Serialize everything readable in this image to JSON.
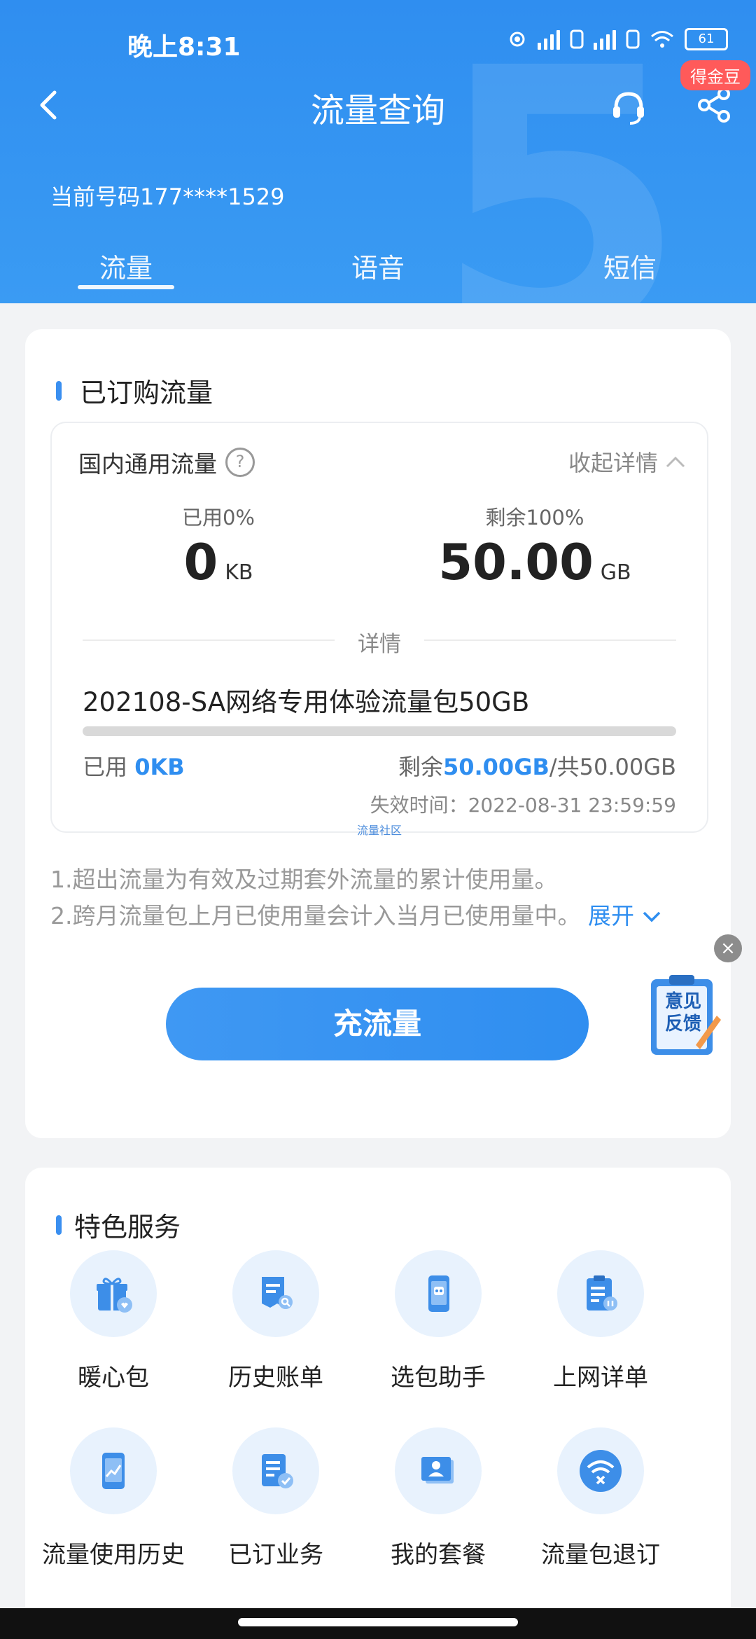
{
  "status_bar": {
    "time": "晚上8:31",
    "battery": "61"
  },
  "navbar": {
    "title": "流量查询",
    "badge": "得金豆"
  },
  "phone_label": "当前号码177****1529",
  "tabs": [
    {
      "label": "流量",
      "active": true
    },
    {
      "label": "语音",
      "active": false
    },
    {
      "label": "短信",
      "active": false
    }
  ],
  "subscribed": {
    "title": "已订购流量",
    "category": "国内通用流量",
    "collapse_label": "收起详情",
    "used_pct_label": "已用0%",
    "used_value": "0",
    "used_unit": "KB",
    "remain_pct_label": "剩余100%",
    "remain_value": "50.00",
    "remain_unit": "GB",
    "divider_label": "详情",
    "package_name": "202108-SA网络专用体验流量包50GB",
    "progress_fraction": 0,
    "used_prefix": "已用 ",
    "used_amount": "0KB",
    "remain_prefix": "剩余",
    "remain_amount": "50.00GB",
    "total_suffix": "/共50.00GB",
    "expire_label": "失效时间：2022-08-31 23:59:59",
    "watermark": "流量社区"
  },
  "notes": {
    "line1": "1.超出流量为有效及过期套外流量的累计使用量。",
    "line2": "2.跨月流量包上月已使用量会计入当月已使用量中。",
    "expand_label": "展开"
  },
  "recharge_label": "充流量",
  "feedback": {
    "line1": "意见",
    "line2": "反馈"
  },
  "services": {
    "title": "特色服务",
    "items": [
      {
        "label": "暖心包",
        "icon": "gift-icon"
      },
      {
        "label": "历史账单",
        "icon": "bill-search-icon"
      },
      {
        "label": "选包助手",
        "icon": "robot-phone-icon"
      },
      {
        "label": "上网详单",
        "icon": "clipboard-icon"
      },
      {
        "label": "流量使用历史",
        "icon": "phone-chart-icon"
      },
      {
        "label": "已订业务",
        "icon": "doc-check-icon"
      },
      {
        "label": "我的套餐",
        "icon": "profile-card-icon"
      },
      {
        "label": "流量包退订",
        "icon": "wifi-cancel-icon"
      }
    ]
  },
  "colors": {
    "primary": "#2f8ef0",
    "badge": "#ff5a5a"
  }
}
